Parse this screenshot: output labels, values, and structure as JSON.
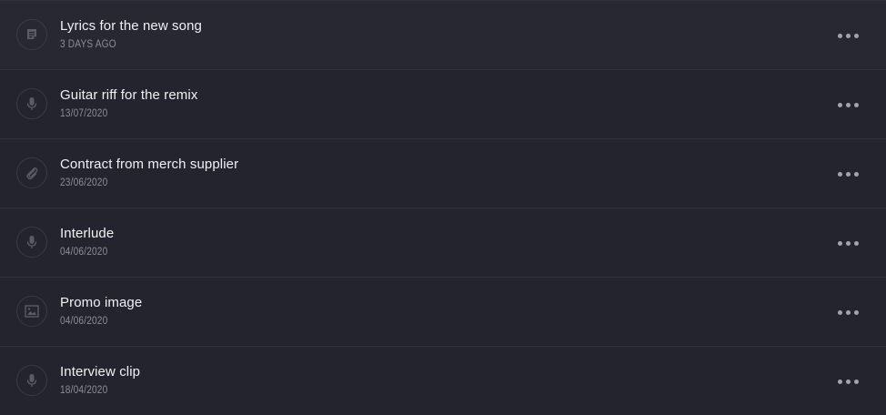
{
  "items": [
    {
      "title": "Lyrics for the new song",
      "date": "3 DAYS AGO",
      "icon": "note-icon"
    },
    {
      "title": "Guitar riff for the remix",
      "date": "13/07/2020",
      "icon": "microphone-icon"
    },
    {
      "title": "Contract from merch supplier",
      "date": "23/06/2020",
      "icon": "paperclip-icon"
    },
    {
      "title": "Interlude",
      "date": "04/06/2020",
      "icon": "microphone-icon"
    },
    {
      "title": "Promo image",
      "date": "04/06/2020",
      "icon": "image-icon"
    },
    {
      "title": "Interview clip",
      "date": "18/04/2020",
      "icon": "microphone-icon"
    }
  ],
  "colors": {
    "background": "#23242d",
    "divider": "#30313b",
    "title": "#f1f1f4",
    "date": "#8c8d97",
    "icon": "#5a5b65",
    "dots": "#a3a4ad"
  }
}
